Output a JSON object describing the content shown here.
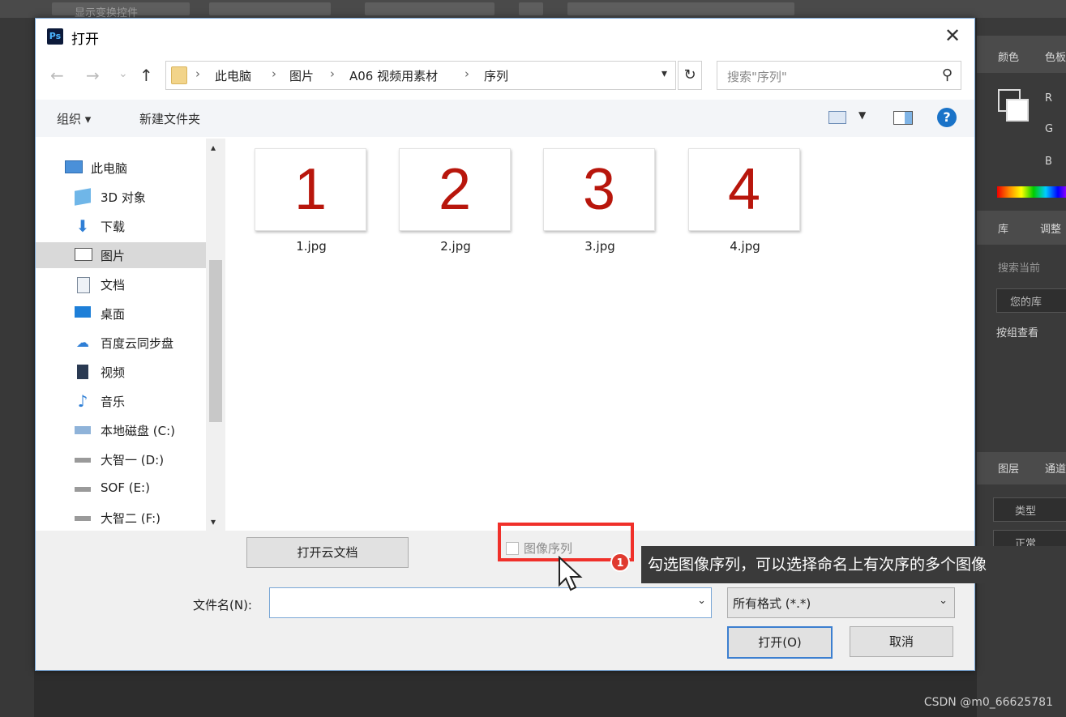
{
  "ps": {
    "top_text": "显示变换控件",
    "panel_color_tab": "颜色",
    "panel_swatch_tab": "色板",
    "panel_lib_tab": "库",
    "panel_adjust_tab": "调整",
    "lib_search": "搜索当前",
    "lib_name": "您的库",
    "lib_view": "按组查看",
    "layers_tab": "图层",
    "channels_tab": "通道",
    "layers_search": "类型",
    "blend": "正常",
    "rgb": [
      "R",
      "G",
      "B"
    ]
  },
  "dialog": {
    "title": "打开",
    "close_glyph": "✕"
  },
  "nav": {
    "back": "←",
    "forward": "→",
    "recent": "⌄",
    "up": "↑",
    "breadcrumbs": [
      "此电脑",
      "图片",
      "A06 视频用素材",
      "序列"
    ],
    "separator": "›",
    "refresh": "↻",
    "search_placeholder": "搜索\"序列\"",
    "search_icon": "⚲"
  },
  "toolbar": {
    "organize": "组织 ▾",
    "new_folder": "新建文件夹",
    "help": "?"
  },
  "sidebar": {
    "items": [
      {
        "label": "此电脑",
        "icon": "computer-icon"
      },
      {
        "label": "3D 对象",
        "icon": "3d-objects-icon"
      },
      {
        "label": "下载",
        "icon": "download-icon"
      },
      {
        "label": "图片",
        "icon": "pictures-icon"
      },
      {
        "label": "文档",
        "icon": "documents-icon"
      },
      {
        "label": "桌面",
        "icon": "desktop-icon"
      },
      {
        "label": "百度云同步盘",
        "icon": "baidu-cloud-icon"
      },
      {
        "label": "视频",
        "icon": "videos-icon"
      },
      {
        "label": "音乐",
        "icon": "music-icon"
      },
      {
        "label": "本地磁盘 (C:)",
        "icon": "drive-c-icon"
      },
      {
        "label": "大智一 (D:)",
        "icon": "drive-icon"
      },
      {
        "label": "SOF (E:)",
        "icon": "drive-icon"
      },
      {
        "label": "大智二 (F:)",
        "icon": "drive-icon"
      }
    ],
    "scroll_up": "▴",
    "scroll_down": "▾"
  },
  "files": [
    {
      "thumb": "1",
      "name": "1.jpg"
    },
    {
      "thumb": "2",
      "name": "2.jpg"
    },
    {
      "thumb": "3",
      "name": "3.jpg"
    },
    {
      "thumb": "4",
      "name": "4.jpg"
    }
  ],
  "bottom": {
    "cloud_button": "打开云文档",
    "sequence_label": "图像序列",
    "sequence_checked": false,
    "filename_label": "文件名(N):",
    "filename_value": "",
    "format_value": "所有格式 (*.*)",
    "open_button": "打开(O)",
    "cancel_button": "取消",
    "dropdown_glyph": "⌄"
  },
  "annotation": {
    "badge": "1",
    "tooltip": "勾选图像序列，可以选择命名上有次序的多个图像"
  },
  "watermark": "CSDN @m0_66625781",
  "colors": {
    "accent_blue": "#1a73c8",
    "highlight_red": "#f0302a",
    "thumb_number": "#b8160c"
  }
}
